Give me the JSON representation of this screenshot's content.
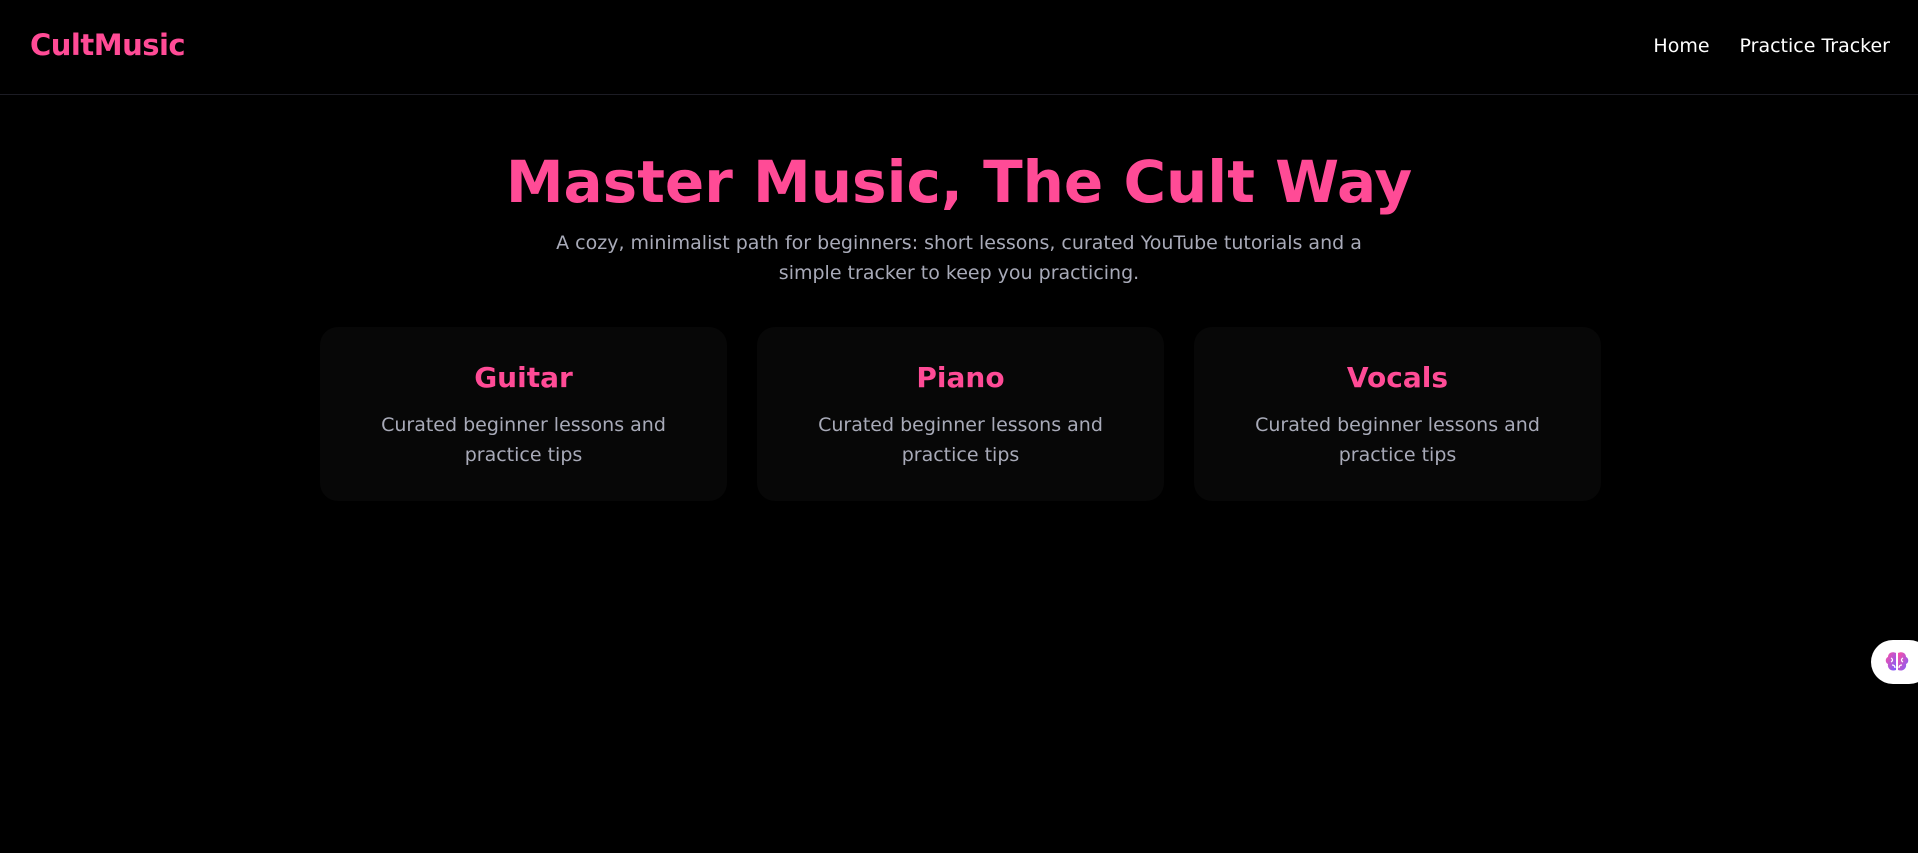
{
  "header": {
    "brand": "CultMusic",
    "nav": [
      {
        "label": "Home"
      },
      {
        "label": "Practice Tracker"
      }
    ]
  },
  "hero": {
    "title": "Master Music, The Cult Way",
    "subtitle": "A cozy, minimalist path for beginners: short lessons, curated YouTube tutorials and a simple tracker to keep you practicing."
  },
  "cards": [
    {
      "title": "Guitar",
      "description": "Curated beginner lessons and practice tips"
    },
    {
      "title": "Piano",
      "description": "Curated beginner lessons and practice tips"
    },
    {
      "title": "Vocals",
      "description": "Curated beginner lessons and practice tips"
    }
  ],
  "floating_button": {
    "icon": "brain-icon"
  },
  "colors": {
    "accent": "#ff4b96",
    "background": "#000000",
    "muted_text": "#a8aab8",
    "card_background": "#070707"
  }
}
